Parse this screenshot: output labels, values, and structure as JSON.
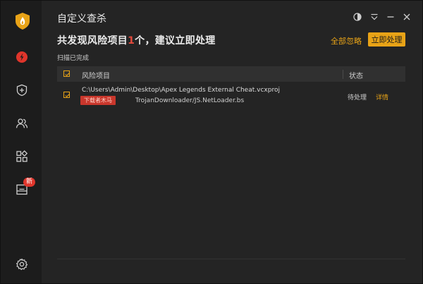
{
  "window": {
    "title": "自定义查杀"
  },
  "sidebar": {
    "items": [
      {
        "icon": "virus-scan-icon"
      },
      {
        "icon": "shield-plus-icon"
      },
      {
        "icon": "users-icon"
      },
      {
        "icon": "apps-grid-icon"
      },
      {
        "icon": "toolbox-icon",
        "badge": "新"
      },
      {
        "icon": "gear-icon"
      }
    ]
  },
  "header": {
    "headline_prefix": "共发现风险项目",
    "headline_count": "1",
    "headline_suffix": "个，建议立即处理",
    "ignore_all_label": "全部忽略",
    "fix_now_label": "立即处理",
    "scan_status": "扫描已完成"
  },
  "table": {
    "columns": [
      "风险项目",
      "状态"
    ],
    "rows": [
      {
        "path": "C:\\Users\\Admin\\Desktop\\Apex Legends External Cheat.vcxproj",
        "tag": "下载者木马",
        "threat": "TrojanDownloader/JS.NetLoader.bs",
        "status": "待处理",
        "detail_label": "详情"
      }
    ]
  },
  "colors": {
    "accent": "#e8a317",
    "danger": "#e34a3c",
    "background": "#242424",
    "sidebar": "#1c1c1c"
  }
}
